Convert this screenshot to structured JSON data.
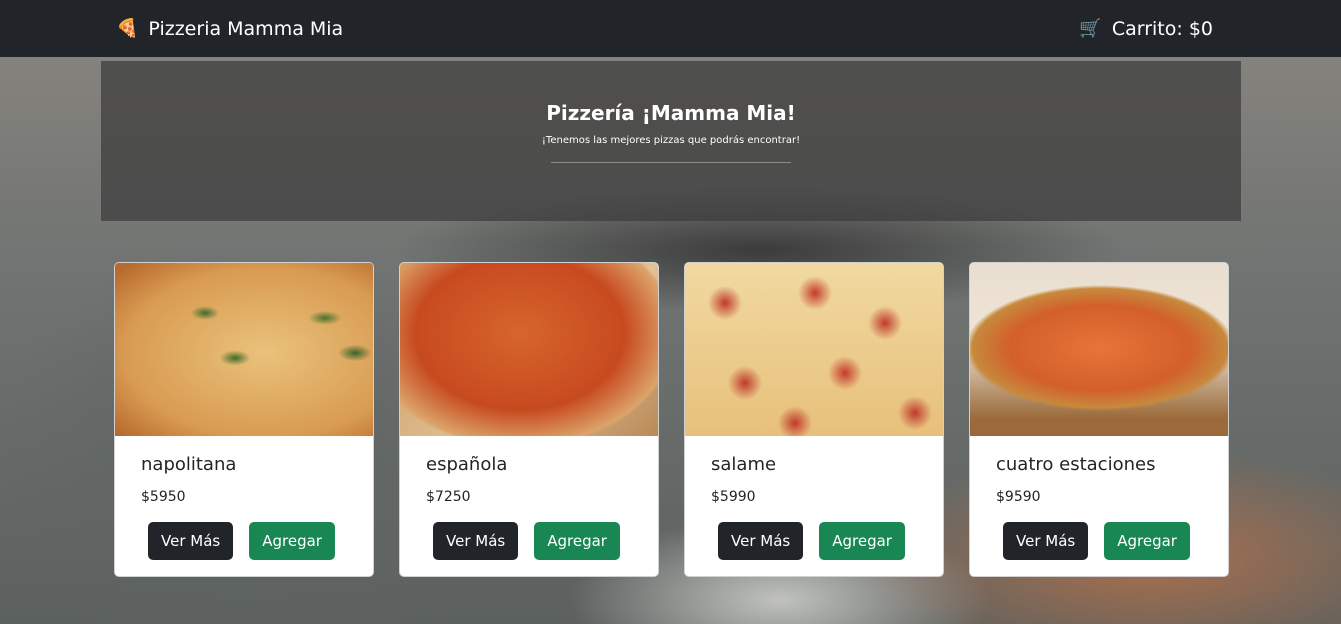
{
  "navbar": {
    "brand_icon": "🍕",
    "brand": "Pizzeria Mamma Mia",
    "cart_icon": "🛒",
    "cart": "Carrito: $0"
  },
  "hero": {
    "title": "Pizzería ¡Mamma Mia!",
    "subtitle": "¡Tenemos las mejores pizzas que podrás encontrar!"
  },
  "pizzas": [
    {
      "name": "napolitana",
      "price": "$5950",
      "more": "Ver Más",
      "add": "Agregar"
    },
    {
      "name": "española",
      "price": "$7250",
      "more": "Ver Más",
      "add": "Agregar"
    },
    {
      "name": "salame",
      "price": "$5990",
      "more": "Ver Más",
      "add": "Agregar"
    },
    {
      "name": "cuatro estaciones",
      "price": "$9590",
      "more": "Ver Más",
      "add": "Agregar"
    }
  ],
  "colors": {
    "navbar": "#212529",
    "primary_dark": "#212529",
    "success": "#198754"
  }
}
